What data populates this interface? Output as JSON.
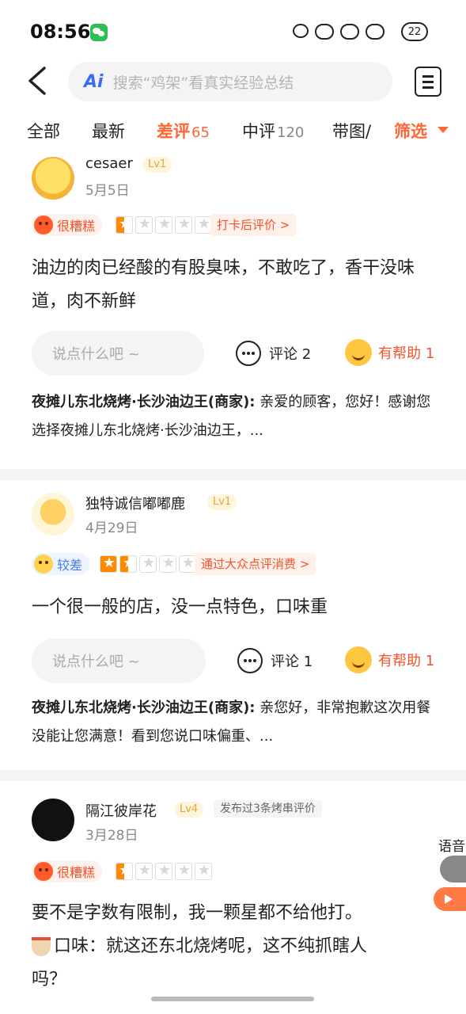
{
  "status_bar": {
    "time": "08:56",
    "battery": "22"
  },
  "header": {
    "ai_label": "Ai",
    "search_placeholder": "搜索“鸡架”看真实经验总结"
  },
  "tabs": [
    {
      "label": "全部",
      "count": ""
    },
    {
      "label": "最新",
      "count": ""
    },
    {
      "label": "差评",
      "count": "65"
    },
    {
      "label": "中评",
      "count": "120"
    },
    {
      "label": "带图/",
      "count": ""
    }
  ],
  "filter_label": "筛选",
  "reviews": [
    {
      "username": "cesaer",
      "level": "Lv1",
      "post_note": "",
      "date": "5月5日",
      "rating_label": "很糟糕",
      "rating_stars": 0.5,
      "source_tag": "打卡后评价 >",
      "text": "油边的肉已经酸的有股臭味，不敢吃了，香干没味道，肉不新鲜",
      "comment_placeholder": "说点什么吧 ~",
      "comments_label": "评论 2",
      "helpful_label": "有帮助 1",
      "reply_merchant": "夜摊儿东北烧烤·长沙油边王(商家):",
      "reply_text": " 亲爱的顾客，您好！感谢您选择夜摊儿东北烧烤·长沙油边王，..."
    },
    {
      "username": "独特诚信嘟嘟鹿",
      "level": "Lv1",
      "post_note": "",
      "date": "4月29日",
      "rating_label": "较差",
      "rating_stars": 1.5,
      "source_tag": "通过大众点评消费 >",
      "text": "一个很一般的店，没一点特色，口味重",
      "comment_placeholder": "说点什么吧 ~",
      "comments_label": "评论 1",
      "helpful_label": "有帮助 1",
      "reply_merchant": "夜摊儿东北烧烤·长沙油边王(商家):",
      "reply_text": " 亲您好，非常抱歉这次用餐没能让您满意！看到您说口味偏重、..."
    },
    {
      "username": "隔江彼岸花",
      "level": "Lv4",
      "post_note": "发布过3条烤串评价",
      "date": "3月28日",
      "rating_label": "很糟糕",
      "rating_stars": 0.5,
      "source_tag": "",
      "text_line1": "要不是字数有限制，我一颗星都不给他打。",
      "text_line2": "口味：就这还东北烧烤呢，这不纯抓瞎人",
      "text_line3": "吗？"
    }
  ],
  "voice_widget": {
    "label": "语音"
  },
  "colors": {
    "accent": "#ff6633",
    "bad": "#f2542d",
    "poor": "#4a7ce8",
    "star": "#ff8a00",
    "level": "#e0a53a"
  }
}
